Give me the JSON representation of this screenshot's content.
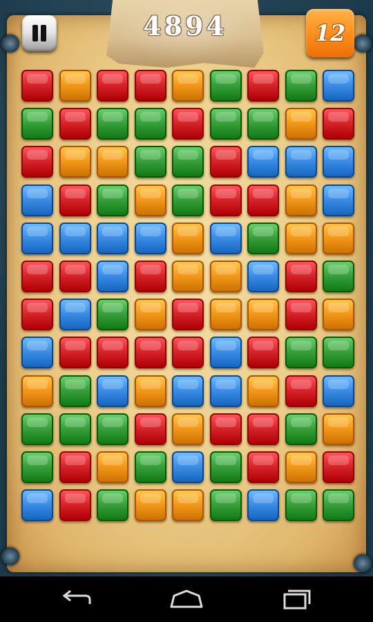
{
  "header": {
    "score": "4894",
    "moves_left": "12"
  },
  "colors": {
    "red": "#d8262c",
    "orange": "#f49a1a",
    "green": "#3aa23c",
    "blue": "#3d8ee6"
  },
  "board": {
    "rows": 12,
    "cols": 9,
    "tiles": [
      [
        "red",
        "orange",
        "red",
        "red",
        "orange",
        "green",
        "red",
        "green",
        "blue"
      ],
      [
        "green",
        "red",
        "green",
        "green",
        "red",
        "green",
        "green",
        "orange",
        "red"
      ],
      [
        "red",
        "orange",
        "orange",
        "green",
        "green",
        "red",
        "blue",
        "blue",
        "blue"
      ],
      [
        "blue",
        "red",
        "green",
        "orange",
        "green",
        "red",
        "red",
        "orange",
        "blue"
      ],
      [
        "blue",
        "blue",
        "blue",
        "blue",
        "orange",
        "blue",
        "green",
        "orange",
        "orange"
      ],
      [
        "red",
        "red",
        "blue",
        "red",
        "orange",
        "orange",
        "blue",
        "red",
        "green"
      ],
      [
        "red",
        "blue",
        "green",
        "orange",
        "red",
        "orange",
        "orange",
        "red",
        "orange"
      ],
      [
        "blue",
        "red",
        "red",
        "red",
        "red",
        "blue",
        "red",
        "green",
        "green"
      ],
      [
        "orange",
        "green",
        "blue",
        "orange",
        "blue",
        "blue",
        "orange",
        "red",
        "blue"
      ],
      [
        "green",
        "green",
        "green",
        "red",
        "orange",
        "red",
        "red",
        "green",
        "orange"
      ],
      [
        "green",
        "red",
        "orange",
        "green",
        "blue",
        "green",
        "red",
        "orange",
        "red"
      ],
      [
        "blue",
        "red",
        "green",
        "orange",
        "orange",
        "green",
        "blue",
        "green",
        "green"
      ]
    ]
  },
  "icons": {
    "pause": "pause-icon",
    "back": "back-arrow-icon",
    "home": "home-icon",
    "recents": "recent-apps-icon"
  }
}
